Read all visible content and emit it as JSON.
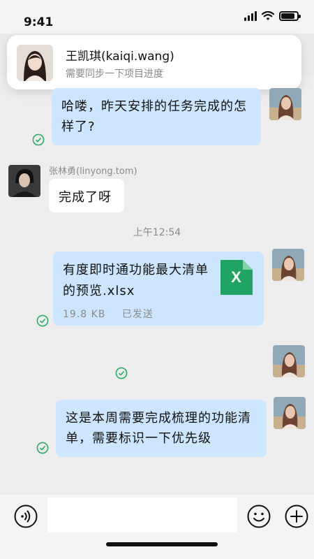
{
  "status_bar": {
    "time": "9:41",
    "battery_level": 0.85
  },
  "notification": {
    "title": "王凯琪(kaiqi.wang)",
    "body": "需要同步一下项目进度"
  },
  "messages": [
    {
      "type": "text",
      "from": "me",
      "text": "哈喽，昨天安排的任务完成的怎样了?",
      "status_icon": "check-circle-icon"
    },
    {
      "type": "text",
      "from": "other",
      "sender": "张林勇(linyong.tom)",
      "text": "完成了呀"
    },
    {
      "type": "timestamp",
      "text": "上午12:54"
    },
    {
      "type": "file",
      "from": "me",
      "file_name": "有度即时通功能最大清单的预览.xlsx",
      "file_size": "19.8 KB",
      "status": "已发送",
      "file_icon": "excel-file-icon",
      "file_icon_letter": "X",
      "status_icon": "check-circle-icon"
    },
    {
      "type": "text",
      "from": "me",
      "text": "",
      "status_icon": "check-circle-icon"
    },
    {
      "type": "text",
      "from": "me",
      "text": "这是本周需要完成梳理的功能清单，需要标识一下优先级",
      "status_icon": "check-circle-icon"
    }
  ],
  "input_bar": {
    "voice_icon": "voice-icon",
    "input_value": "",
    "emoji_icon": "emoji-icon",
    "plus_icon": "plus-icon"
  },
  "colors": {
    "my_bubble": "#cce6ff",
    "other_bubble": "#ffffff",
    "check_green": "#2aae67",
    "excel_green": "#1fa463"
  }
}
